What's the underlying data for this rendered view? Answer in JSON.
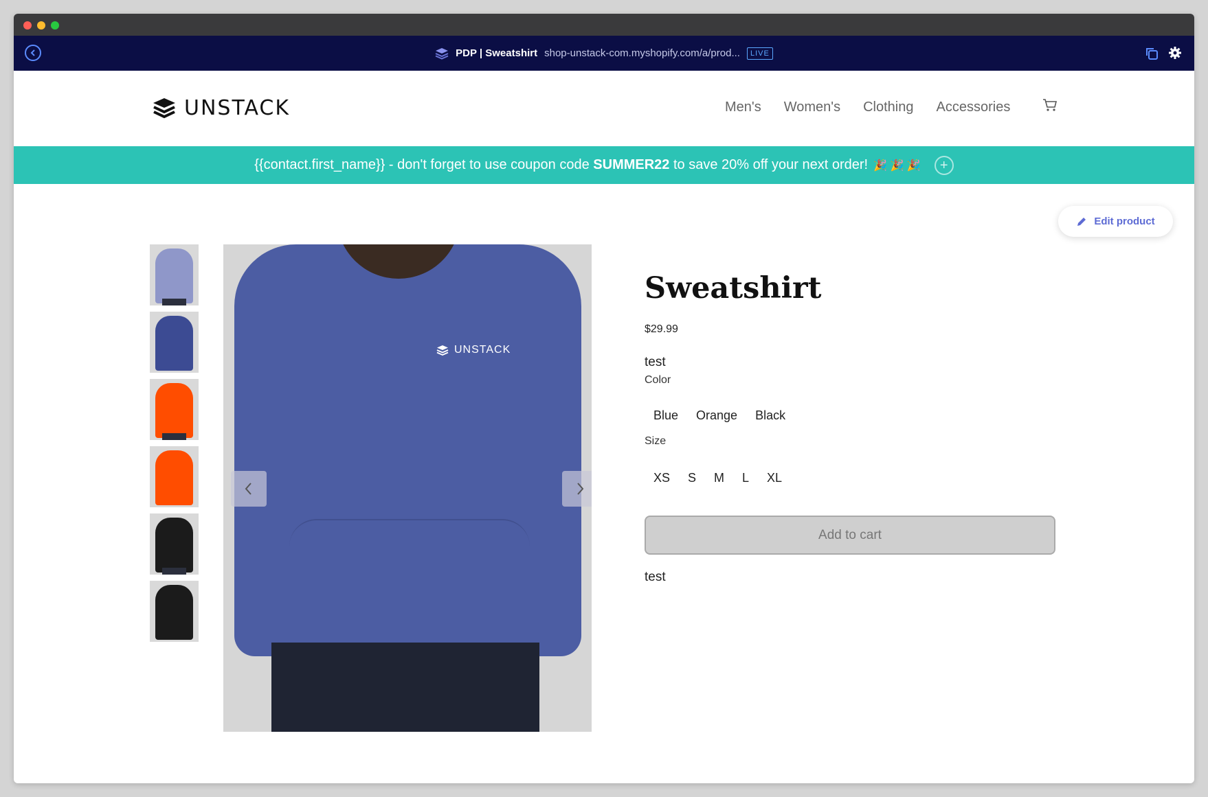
{
  "editor": {
    "page_name": "PDP | Sweatshirt",
    "url": "shop-unstack-com.myshopify.com/a/prod...",
    "status": "LIVE"
  },
  "site": {
    "logo": "UNSTACK",
    "nav": [
      "Men's",
      "Women's",
      "Clothing",
      "Accessories"
    ]
  },
  "promo": {
    "text_before": "{{contact.first_name}} - don't forget to use coupon code ",
    "code": "SUMMER22",
    "text_after": " to save 20% off your next order!",
    "emoji": "🎉 🎉 🎉"
  },
  "edit_button": "Edit product",
  "thumbnails": [
    {
      "color": "#8f97c9"
    },
    {
      "color": "#3c4b93"
    },
    {
      "color": "#ff4d00"
    },
    {
      "color": "#ff4d00"
    },
    {
      "color": "#1b1b1b"
    },
    {
      "color": "#1b1b1b"
    }
  ],
  "main_image": {
    "brand": "UNSTACK"
  },
  "product": {
    "title": "Sweatshirt",
    "price": "$29.99",
    "description": "test",
    "color_label": "Color",
    "colors": [
      "Blue",
      "Orange",
      "Black"
    ],
    "size_label": "Size",
    "sizes": [
      "XS",
      "S",
      "M",
      "L",
      "XL"
    ],
    "add_to_cart": "Add to cart",
    "note": "test"
  }
}
